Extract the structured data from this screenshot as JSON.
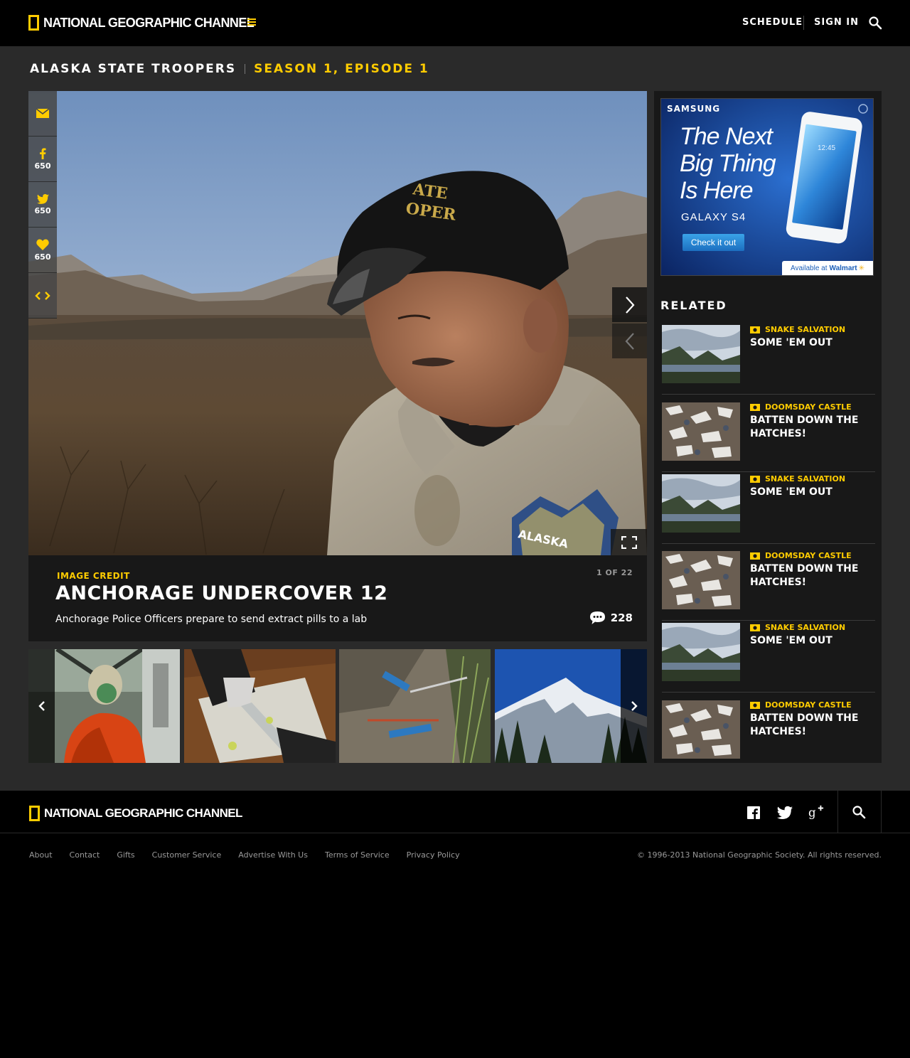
{
  "header": {
    "logo_text": "NATIONAL GEOGRAPHIC CHANNEL",
    "nav": {
      "schedule": "SCHEDULE",
      "sign_in": "SIGN IN"
    },
    "icons": [
      "menu-icon",
      "search-icon"
    ]
  },
  "show": {
    "name": "ALASKA STATE TROOPERS",
    "episode": "SEASON 1, EPISODE 1"
  },
  "share": {
    "facebook_count": "650",
    "twitter_count": "650",
    "like_count": "650",
    "icons": [
      "email-icon",
      "facebook-icon",
      "twitter-icon",
      "heart-icon",
      "embed-icon"
    ]
  },
  "hero": {
    "cap_text": [
      "ATE",
      "OPER"
    ],
    "patch_text": "ALASKA"
  },
  "caption": {
    "credit": "IMAGE CREDIT",
    "counter": "1 OF 22",
    "title": "ANCHORAGE UNDERCOVER 12",
    "description": "Anchorage Police Officers prepare to send extract pills to a lab",
    "comment_count": "228"
  },
  "ad": {
    "brand": "SAMSUNG",
    "headline": "The Next Big Thing Is Here",
    "product": "GALAXY S4",
    "cta": "Check it out",
    "retailer_prefix": "Available at",
    "retailer": "Walmart",
    "phone_time": "12:45"
  },
  "related": {
    "heading": "RELATED",
    "items": [
      {
        "category": "SNAKE SALVATION",
        "title": "SOME 'EM OUT"
      },
      {
        "category": "DOOMSDAY CASTLE",
        "title": "BATTEN DOWN THE HATCHES!"
      },
      {
        "category": "SNAKE SALVATION",
        "title": "SOME 'EM OUT"
      },
      {
        "category": "DOOMSDAY CASTLE",
        "title": "BATTEN DOWN THE HATCHES!"
      },
      {
        "category": "SNAKE SALVATION",
        "title": "SOME 'EM OUT"
      },
      {
        "category": "DOOMSDAY CASTLE",
        "title": "BATTEN DOWN THE HATCHES!"
      }
    ]
  },
  "footer": {
    "logo_text": "NATIONAL GEOGRAPHIC CHANNEL",
    "links": [
      "About",
      "Contact",
      "Gifts",
      "Customer Service",
      "Advertise With Us",
      "Terms of Service",
      "Privacy Policy"
    ],
    "copyright": "© 1996-2013 National Geographic Society. All rights reserved."
  },
  "colors": {
    "accent": "#ffcc00",
    "bg": "#2a2a2a",
    "panel": "#181818"
  }
}
